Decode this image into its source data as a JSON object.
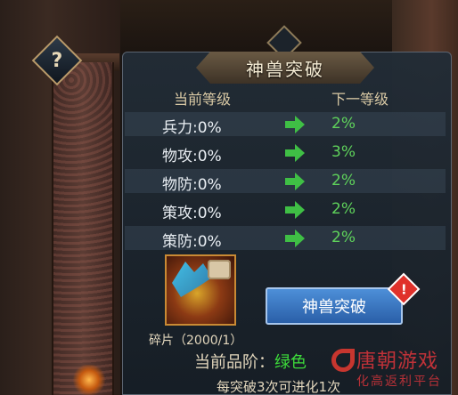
{
  "panel": {
    "title": "神兽突破",
    "current_level_header": "当前等级",
    "next_level_header": "下一等级"
  },
  "stats": [
    {
      "label": "兵力:0%",
      "next": "2%"
    },
    {
      "label": "物攻:0%",
      "next": "3%"
    },
    {
      "label": "物防:0%",
      "next": "2%"
    },
    {
      "label": "策攻:0%",
      "next": "2%"
    },
    {
      "label": "策防:0%",
      "next": "2%"
    }
  ],
  "fragment": {
    "label": "碎片（2000/1）"
  },
  "breakthrough_button": "神兽突破",
  "quality": {
    "prefix": "当前品阶：",
    "value": "绿色"
  },
  "note": "每突破3次可进化1次",
  "help_icon_text": "?",
  "alert_icon_text": "!",
  "watermark": {
    "text": "唐朝游戏",
    "sub": "化高返利平台"
  },
  "colors": {
    "stat_value": "#5fd35b",
    "quality_green": "#3ddc3a",
    "button_blue": "#3b78c4",
    "alert_red": "#e0312b"
  }
}
